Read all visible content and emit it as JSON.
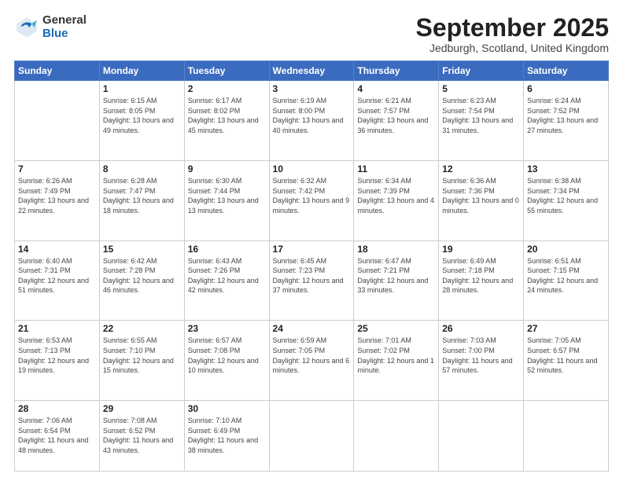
{
  "logo": {
    "general": "General",
    "blue": "Blue"
  },
  "title": "September 2025",
  "location": "Jedburgh, Scotland, United Kingdom",
  "weekdays": [
    "Sunday",
    "Monday",
    "Tuesday",
    "Wednesday",
    "Thursday",
    "Friday",
    "Saturday"
  ],
  "weeks": [
    [
      {
        "day": "",
        "sunrise": "",
        "sunset": "",
        "daylight": ""
      },
      {
        "day": "1",
        "sunrise": "Sunrise: 6:15 AM",
        "sunset": "Sunset: 8:05 PM",
        "daylight": "Daylight: 13 hours and 49 minutes."
      },
      {
        "day": "2",
        "sunrise": "Sunrise: 6:17 AM",
        "sunset": "Sunset: 8:02 PM",
        "daylight": "Daylight: 13 hours and 45 minutes."
      },
      {
        "day": "3",
        "sunrise": "Sunrise: 6:19 AM",
        "sunset": "Sunset: 8:00 PM",
        "daylight": "Daylight: 13 hours and 40 minutes."
      },
      {
        "day": "4",
        "sunrise": "Sunrise: 6:21 AM",
        "sunset": "Sunset: 7:57 PM",
        "daylight": "Daylight: 13 hours and 36 minutes."
      },
      {
        "day": "5",
        "sunrise": "Sunrise: 6:23 AM",
        "sunset": "Sunset: 7:54 PM",
        "daylight": "Daylight: 13 hours and 31 minutes."
      },
      {
        "day": "6",
        "sunrise": "Sunrise: 6:24 AM",
        "sunset": "Sunset: 7:52 PM",
        "daylight": "Daylight: 13 hours and 27 minutes."
      }
    ],
    [
      {
        "day": "7",
        "sunrise": "Sunrise: 6:26 AM",
        "sunset": "Sunset: 7:49 PM",
        "daylight": "Daylight: 13 hours and 22 minutes."
      },
      {
        "day": "8",
        "sunrise": "Sunrise: 6:28 AM",
        "sunset": "Sunset: 7:47 PM",
        "daylight": "Daylight: 13 hours and 18 minutes."
      },
      {
        "day": "9",
        "sunrise": "Sunrise: 6:30 AM",
        "sunset": "Sunset: 7:44 PM",
        "daylight": "Daylight: 13 hours and 13 minutes."
      },
      {
        "day": "10",
        "sunrise": "Sunrise: 6:32 AM",
        "sunset": "Sunset: 7:42 PM",
        "daylight": "Daylight: 13 hours and 9 minutes."
      },
      {
        "day": "11",
        "sunrise": "Sunrise: 6:34 AM",
        "sunset": "Sunset: 7:39 PM",
        "daylight": "Daylight: 13 hours and 4 minutes."
      },
      {
        "day": "12",
        "sunrise": "Sunrise: 6:36 AM",
        "sunset": "Sunset: 7:36 PM",
        "daylight": "Daylight: 13 hours and 0 minutes."
      },
      {
        "day": "13",
        "sunrise": "Sunrise: 6:38 AM",
        "sunset": "Sunset: 7:34 PM",
        "daylight": "Daylight: 12 hours and 55 minutes."
      }
    ],
    [
      {
        "day": "14",
        "sunrise": "Sunrise: 6:40 AM",
        "sunset": "Sunset: 7:31 PM",
        "daylight": "Daylight: 12 hours and 51 minutes."
      },
      {
        "day": "15",
        "sunrise": "Sunrise: 6:42 AM",
        "sunset": "Sunset: 7:28 PM",
        "daylight": "Daylight: 12 hours and 46 minutes."
      },
      {
        "day": "16",
        "sunrise": "Sunrise: 6:43 AM",
        "sunset": "Sunset: 7:26 PM",
        "daylight": "Daylight: 12 hours and 42 minutes."
      },
      {
        "day": "17",
        "sunrise": "Sunrise: 6:45 AM",
        "sunset": "Sunset: 7:23 PM",
        "daylight": "Daylight: 12 hours and 37 minutes."
      },
      {
        "day": "18",
        "sunrise": "Sunrise: 6:47 AM",
        "sunset": "Sunset: 7:21 PM",
        "daylight": "Daylight: 12 hours and 33 minutes."
      },
      {
        "day": "19",
        "sunrise": "Sunrise: 6:49 AM",
        "sunset": "Sunset: 7:18 PM",
        "daylight": "Daylight: 12 hours and 28 minutes."
      },
      {
        "day": "20",
        "sunrise": "Sunrise: 6:51 AM",
        "sunset": "Sunset: 7:15 PM",
        "daylight": "Daylight: 12 hours and 24 minutes."
      }
    ],
    [
      {
        "day": "21",
        "sunrise": "Sunrise: 6:53 AM",
        "sunset": "Sunset: 7:13 PM",
        "daylight": "Daylight: 12 hours and 19 minutes."
      },
      {
        "day": "22",
        "sunrise": "Sunrise: 6:55 AM",
        "sunset": "Sunset: 7:10 PM",
        "daylight": "Daylight: 12 hours and 15 minutes."
      },
      {
        "day": "23",
        "sunrise": "Sunrise: 6:57 AM",
        "sunset": "Sunset: 7:08 PM",
        "daylight": "Daylight: 12 hours and 10 minutes."
      },
      {
        "day": "24",
        "sunrise": "Sunrise: 6:59 AM",
        "sunset": "Sunset: 7:05 PM",
        "daylight": "Daylight: 12 hours and 6 minutes."
      },
      {
        "day": "25",
        "sunrise": "Sunrise: 7:01 AM",
        "sunset": "Sunset: 7:02 PM",
        "daylight": "Daylight: 12 hours and 1 minute."
      },
      {
        "day": "26",
        "sunrise": "Sunrise: 7:03 AM",
        "sunset": "Sunset: 7:00 PM",
        "daylight": "Daylight: 11 hours and 57 minutes."
      },
      {
        "day": "27",
        "sunrise": "Sunrise: 7:05 AM",
        "sunset": "Sunset: 6:57 PM",
        "daylight": "Daylight: 11 hours and 52 minutes."
      }
    ],
    [
      {
        "day": "28",
        "sunrise": "Sunrise: 7:06 AM",
        "sunset": "Sunset: 6:54 PM",
        "daylight": "Daylight: 11 hours and 48 minutes."
      },
      {
        "day": "29",
        "sunrise": "Sunrise: 7:08 AM",
        "sunset": "Sunset: 6:52 PM",
        "daylight": "Daylight: 11 hours and 43 minutes."
      },
      {
        "day": "30",
        "sunrise": "Sunrise: 7:10 AM",
        "sunset": "Sunset: 6:49 PM",
        "daylight": "Daylight: 11 hours and 38 minutes."
      },
      {
        "day": "",
        "sunrise": "",
        "sunset": "",
        "daylight": ""
      },
      {
        "day": "",
        "sunrise": "",
        "sunset": "",
        "daylight": ""
      },
      {
        "day": "",
        "sunrise": "",
        "sunset": "",
        "daylight": ""
      },
      {
        "day": "",
        "sunrise": "",
        "sunset": "",
        "daylight": ""
      }
    ]
  ]
}
